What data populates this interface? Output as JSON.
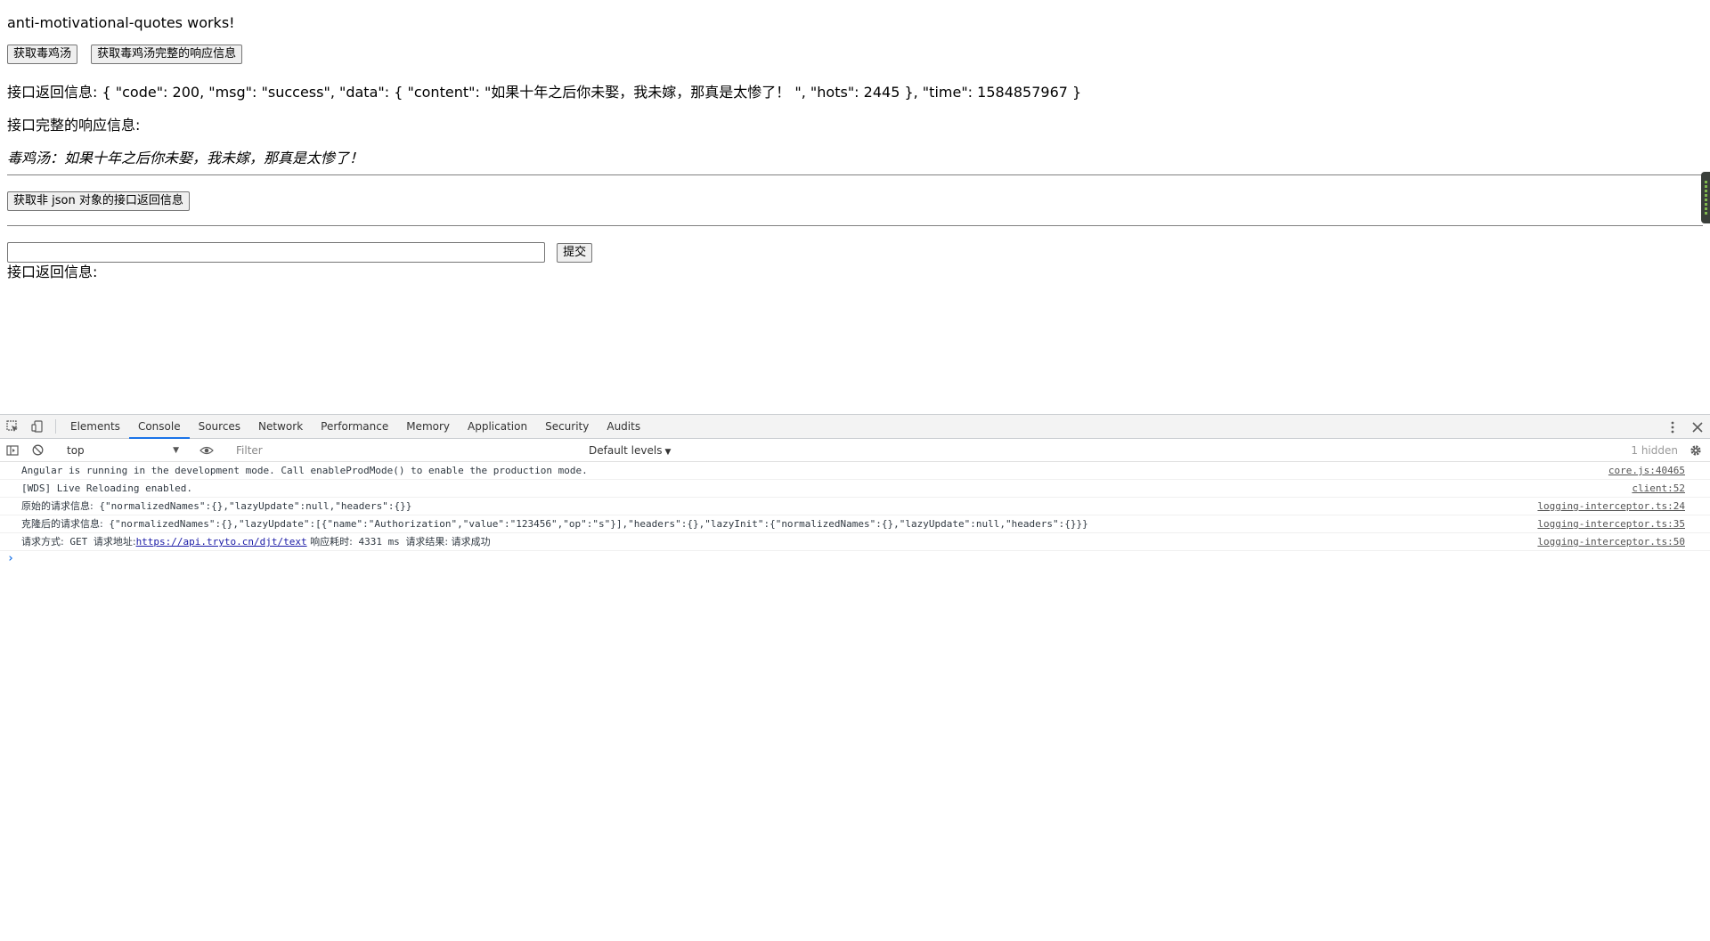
{
  "app": {
    "title": "anti-motivational-quotes works!",
    "btn_get_soup": "获取毒鸡汤",
    "btn_get_full_response": "获取毒鸡汤完整的响应信息",
    "response_line": "接口返回信息: { \"code\": 200, \"msg\": \"success\", \"data\": { \"content\": \"如果十年之后你未娶，我未嫁，那真是太惨了！ \", \"hots\": 2445 }, \"time\": 1584857967 }",
    "full_response_label": "接口完整的响应信息:",
    "quote_line": "毒鸡汤：如果十年之后你未娶，我未嫁，那真是太惨了！",
    "btn_non_json": "获取非 json 对象的接口返回信息",
    "input_value": "",
    "btn_submit": "提交",
    "result_label": "接口返回信息:"
  },
  "devtools": {
    "tabs": [
      "Elements",
      "Console",
      "Sources",
      "Network",
      "Performance",
      "Memory",
      "Application",
      "Security",
      "Audits"
    ],
    "active_tab": "Console",
    "toolbar": {
      "context": "top",
      "filter_placeholder": "Filter",
      "levels": "Default levels",
      "hidden": "1 hidden"
    },
    "console": {
      "row1": {
        "text": "Angular is running in the development mode. Call enableProdMode() to enable the production mode.",
        "source": "core.js:40465"
      },
      "row2": {
        "text": "[WDS] Live Reloading enabled.",
        "source": "client:52"
      },
      "row3": {
        "label": "原始的请求信息:",
        "text": " {\"normalizedNames\":{},\"lazyUpdate\":null,\"headers\":{}}",
        "source": "logging-interceptor.ts:24"
      },
      "row4": {
        "label": "克隆后的请求信息:",
        "text": " {\"normalizedNames\":{},\"lazyUpdate\":[{\"name\":\"Authorization\",\"value\":\"123456\",\"op\":\"s\"}],\"headers\":{},\"lazyInit\":{\"normalizedNames\":{},\"lazyUpdate\":null,\"headers\":{}}}",
        "source": "logging-interceptor.ts:35"
      },
      "row5": {
        "method_label": "请求方式:",
        "method": " GET ",
        "url_label": "请求地址:",
        "url": "https://api.tryto.cn/djt/text",
        "time_label": " 响应耗时:",
        "time": " 4331 ms ",
        "result_label": "请求结果:",
        "result": " 请求成功",
        "source": "logging-interceptor.ts:50"
      }
    }
  }
}
